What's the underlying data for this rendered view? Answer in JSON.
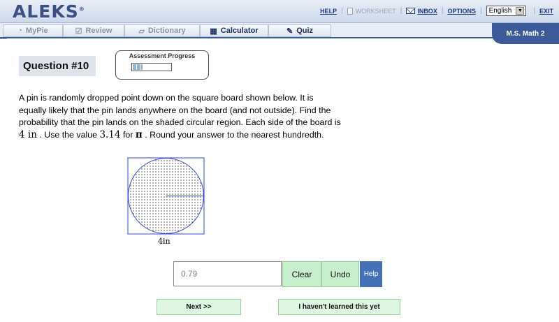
{
  "app": {
    "logo": "ALEKS",
    "logo_mark": "®"
  },
  "header_links": {
    "help": "HELP",
    "worksheet": "WORKSHEET",
    "inbox": "INBOX",
    "options": "OPTIONS",
    "language": "English",
    "exit": "EXIT"
  },
  "tabs": [
    {
      "label": "MyPie",
      "icon": "pie-icon"
    },
    {
      "label": "Review",
      "icon": "checkmark-icon"
    },
    {
      "label": "Dictionary",
      "icon": "book-icon"
    },
    {
      "label": "Calculator",
      "icon": "calculator-icon"
    },
    {
      "label": "Quiz",
      "icon": "quiz-icon"
    }
  ],
  "course": "M.S. Math 2",
  "question": {
    "title": "Question #10",
    "progress_label": "Assessment Progress",
    "progress_fraction": 0.25
  },
  "problem": {
    "line1": "A pin is randomly dropped point down on the square board shown below. It is",
    "line2": "equally likely that the pin lands anywhere on the board (and not outside). Find the",
    "line3": "probability that the pin lands on the shaded circular region. Each side of the board is",
    "side_value": "4 in",
    "text_a": ". Use the value",
    "pi_value": "3.14",
    "text_b": "for",
    "pi_symbol": "π",
    "text_c": ". Round your answer to the nearest hundredth."
  },
  "figure": {
    "side_label": "4in"
  },
  "answer": {
    "value": "0.79"
  },
  "buttons": {
    "clear": "Clear",
    "undo": "Undo",
    "help": "Help",
    "next": "Next >>",
    "not_learned": "I haven't learned this yet"
  },
  "colors": {
    "accent": "#3c5a99",
    "green_button": "#c7efcd",
    "help_button": "#4472b4"
  }
}
